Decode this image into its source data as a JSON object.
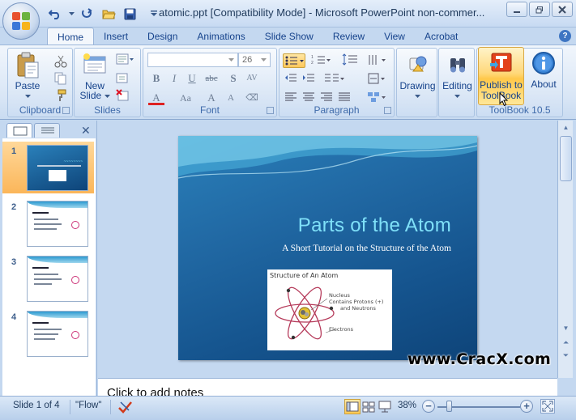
{
  "window": {
    "title": "atomic.ppt [Compatibility Mode] - Microsoft PowerPoint non-commer...",
    "controls": [
      "minimize",
      "restore",
      "close"
    ]
  },
  "quick_access": {
    "icons": [
      "undo-icon",
      "redo-icon",
      "open-icon",
      "save-icon",
      "customize-icon"
    ]
  },
  "tabs": [
    "Home",
    "Insert",
    "Design",
    "Animations",
    "Slide Show",
    "Review",
    "View",
    "Acrobat"
  ],
  "active_tab": "Home",
  "ribbon": {
    "clipboard": {
      "label": "Clipboard",
      "paste": "Paste"
    },
    "slides": {
      "label": "Slides",
      "new_slide_line1": "New",
      "new_slide_line2": "Slide"
    },
    "font": {
      "label": "Font",
      "font_name": "",
      "font_size": "26"
    },
    "paragraph": {
      "label": "Paragraph"
    },
    "drawing": {
      "label": "Drawing"
    },
    "editing": {
      "label": "Editing"
    },
    "toolbook": {
      "label": "ToolBook 10.5",
      "publish_line1": "Publish to",
      "publish_line2": "ToolBook",
      "about": "About"
    }
  },
  "slide": {
    "title": "Parts of the Atom",
    "subtitle": "A Short Tutorial on the Structure of the Atom",
    "figure": {
      "caption": "Structure of An Atom",
      "nucleus_label_1": "Nucleus",
      "nucleus_label_2": "Contains Protons (+)",
      "nucleus_label_3": "and Neutrons",
      "electrons_label": "Electrons"
    }
  },
  "thumbnails": [
    {
      "number": "1",
      "selected": true
    },
    {
      "number": "2",
      "selected": false
    },
    {
      "number": "3",
      "selected": false
    },
    {
      "number": "4",
      "selected": false
    }
  ],
  "notes": {
    "placeholder": "Click to add notes"
  },
  "watermark": "www.CracX.com",
  "status": {
    "slide_info": "Slide 1 of 4",
    "theme": "\"Flow\"",
    "zoom": "38%"
  },
  "colors": {
    "slide_title": "#7fe0f8",
    "slide_background": "#1c5f9b",
    "selected_thumbnail": "#fbb65a",
    "ribbon": "#d9e6f6"
  }
}
